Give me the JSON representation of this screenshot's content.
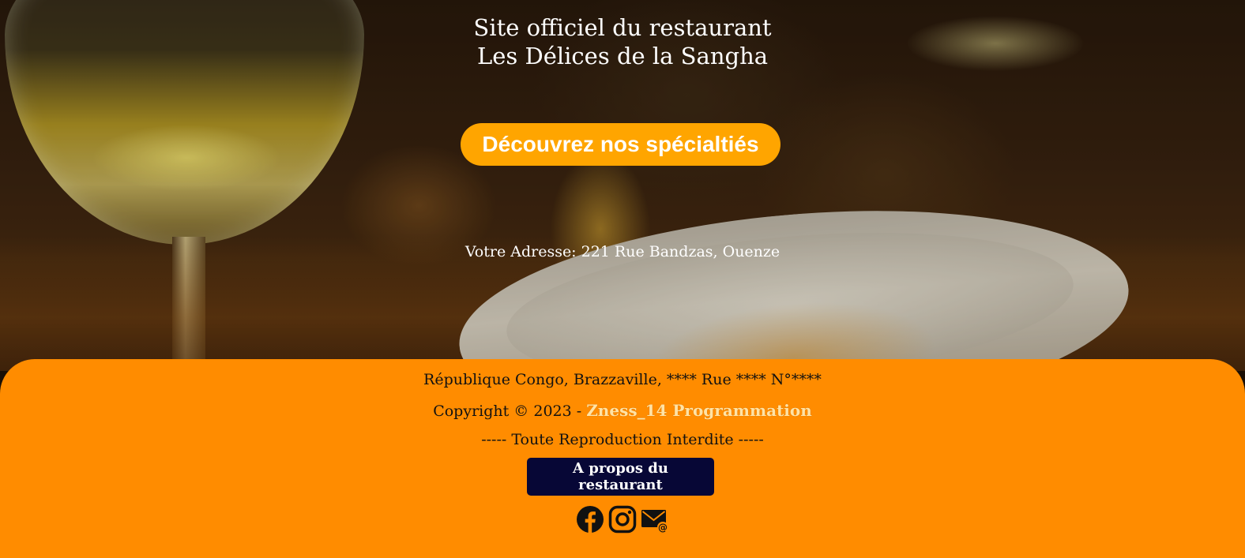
{
  "hero": {
    "title_line1": "Site officiel du restaurant",
    "title_line2": "Les Délices de la Sangha",
    "cta_label": "Découvrez nos spécialtiés",
    "address": "Votre Adresse: 221 Rue Bandzas, Ouenze"
  },
  "footer": {
    "location": "République Congo, Brazzaville, **** Rue **** N°****",
    "copyright_prefix": "Copyright © 2023 - ",
    "copyright_link": "Zness_14 Programmation",
    "notice": "----- Toute Reproduction Interdite -----",
    "about_button": "A propos du restaurant",
    "social_icons": [
      "facebook-icon",
      "instagram-icon",
      "email-icon"
    ]
  },
  "colors": {
    "accent": "#ffa500",
    "footer_background": "#ff8c00",
    "about_button_background": "#070736",
    "link": "#ffe3a6"
  }
}
